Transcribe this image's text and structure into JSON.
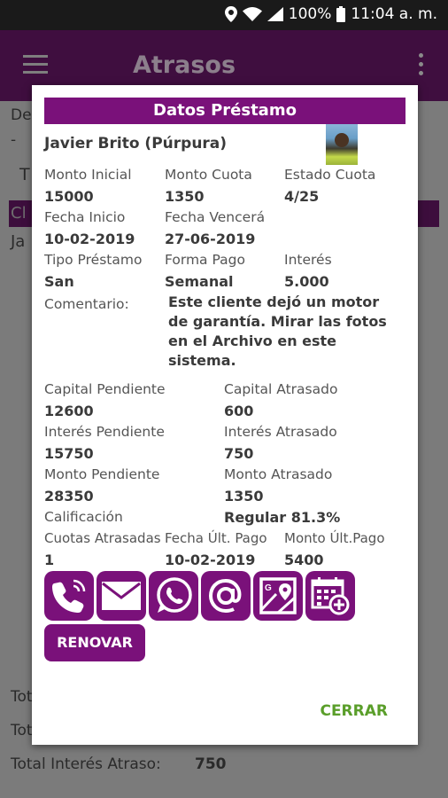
{
  "status_bar": {
    "battery_percent": "100%",
    "time": "11:04 a. m."
  },
  "app_bar": {
    "title": "Atrasos"
  },
  "background": {
    "line1": "De",
    "line2": "-",
    "line3": "T",
    "purple_row": "Cl",
    "row_text": "Ja",
    "tot1": "Tot",
    "tot2": "Tot",
    "total_interes_label": "Total Interés Atraso:",
    "total_interes_value": "750"
  },
  "dialog": {
    "header": "Datos Préstamo",
    "client_name": "Javier Brito (Púrpura)",
    "fields": {
      "monto_inicial_label": "Monto Inicial",
      "monto_inicial": "15000",
      "monto_cuota_label": "Monto Cuota",
      "monto_cuota": "1350",
      "estado_cuota_label": "Estado Cuota",
      "estado_cuota": "4/25",
      "fecha_inicio_label": "Fecha Inicio",
      "fecha_inicio": "10-02-2019",
      "fecha_vencera_label": "Fecha Vencerá",
      "fecha_vencera": "27-06-2019",
      "tipo_prestamo_label": "Tipo Préstamo",
      "tipo_prestamo": "San",
      "forma_pago_label": "Forma Pago",
      "forma_pago": "Semanal",
      "interes_label": "Interés",
      "interes": "5.000",
      "comentario_label": "Comentario:",
      "comentario": "Este cliente dejó un motor de garantía. Mirar las fotos en el Archivo en este sistema.",
      "capital_pendiente_label": "Capital Pendiente",
      "capital_pendiente": "12600",
      "capital_atrasado_label": "Capital Atrasado",
      "capital_atrasado": "600",
      "interes_pendiente_label": "Interés Pendiente",
      "interes_pendiente": "15750",
      "interes_atrasado_label": "Interés Atrasado",
      "interes_atrasado": "750",
      "monto_pendiente_label": "Monto Pendiente",
      "monto_pendiente": "28350",
      "monto_atrasado_label": "Monto Atrasado",
      "monto_atrasado": "1350",
      "calificacion_label": "Calificación",
      "calificacion": "Regular 81.3%",
      "cuotas_atrasadas_label": "Cuotas Atrasadas",
      "cuotas_atrasadas": "1",
      "fecha_ult_pago_label": "Fecha Últ. Pago",
      "fecha_ult_pago": "10-02-2019",
      "monto_ult_pago_label": "Monto Últ.Pago",
      "monto_ult_pago": "5400"
    },
    "actions": {
      "icons": [
        "phone-icon",
        "email-icon",
        "whatsapp-icon",
        "at-icon",
        "map-icon",
        "calendar-add-icon"
      ],
      "renovar": "RENOVAR",
      "cerrar": "CERRAR"
    }
  },
  "colors": {
    "primary": "#7a117a",
    "appbar": "#3f0e3f",
    "accent_green": "#5a9e2a"
  }
}
